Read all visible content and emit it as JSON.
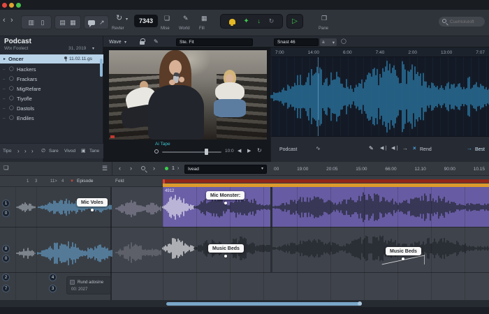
{
  "toolbar": {
    "rotate_label": "Revter",
    "counter_value": "7343",
    "mixe_label": "Mise",
    "world_label": "World",
    "fill_label": "Fill",
    "pane_label": "Pane",
    "search_placeholder": "Cuehtoluloft"
  },
  "sidebar": {
    "title": "Podcast",
    "subtitle": "Wtx Foolect",
    "date_label": "31, 2019",
    "selected_item": {
      "label": "Oncer",
      "meta": "11.02.11.gs"
    },
    "items": [
      {
        "label": "Hackers"
      },
      {
        "label": "Frackars"
      },
      {
        "label": "MigRefare"
      },
      {
        "label": "Tiyofle"
      },
      {
        "label": "Dastols"
      },
      {
        "label": "Endiles"
      }
    ],
    "footer": {
      "f1": "Tipo",
      "f2": "Sare",
      "f3": "Vivod",
      "f4": "Tane"
    }
  },
  "preview": {
    "mode_label": "Wave",
    "name_field": "Ste. Fit",
    "caption": "Ai Tape",
    "time_label": "10:0"
  },
  "wave_panel": {
    "name_field": "Snast 46",
    "zoom_value": "a",
    "ruler": [
      "7:00",
      "14:00",
      "6:00",
      "7:40",
      "2:00",
      "13:00",
      "7:07"
    ],
    "footer_left": "Podcast",
    "rend_label": "Rend",
    "best_label": "Best"
  },
  "timeline": {
    "take_value": "1",
    "search_value": "Ivead",
    "ruler": [
      "00",
      "19:00",
      "20:05",
      "15:00",
      "66:00",
      "12.10",
      "90:00",
      "10.15"
    ],
    "header": {
      "n1": "1",
      "n2": "3",
      "n3": "11>",
      "n4": "4",
      "episode_label": "Episode",
      "feld_label": "Feld"
    },
    "clip_id": "4912",
    "tooltips": {
      "mic_voices": "Mic Voles",
      "mic_monster": "Mic Monster:",
      "music_beds_1": "Music Beds",
      "music_beds_2": "Music Beds"
    },
    "tracks": {
      "t1_buttons": [
        "1",
        "0"
      ],
      "t2_buttons": [
        "8",
        "0"
      ],
      "t3_buttons": [
        "2",
        "7"
      ],
      "t3_buttons2": [
        "4",
        "3"
      ]
    },
    "checkbox_label": "Rund adosine",
    "checkbox_sub": "00: 2027"
  },
  "colors": {
    "accent_blue": "#2c7aa6",
    "selection_blue": "#b9d3e8",
    "clip_purple": "#6b5fa8",
    "marker_red": "#8f2619",
    "marker_orange": "#dd9a2c",
    "play_green": "#3fc94f",
    "bell_yellow": "#e6b923",
    "caption_cyan": "#3ec3cc",
    "scrollbar_blue": "#7aa7c8"
  }
}
